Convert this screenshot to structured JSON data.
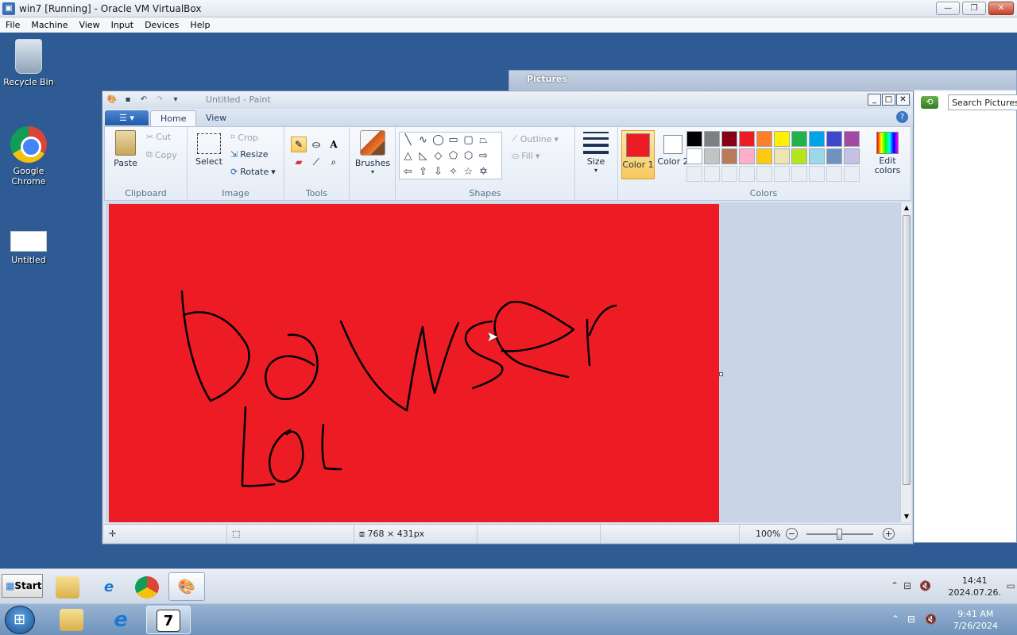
{
  "vbox": {
    "title": "win7 [Running] - Oracle VM VirtualBox",
    "menu": [
      "File",
      "Machine",
      "View",
      "Input",
      "Devices",
      "Help"
    ]
  },
  "desktop": {
    "icons": [
      {
        "label": "Recycle Bin",
        "icon": "recycle-bin-icon"
      },
      {
        "label": "Google Chrome",
        "icon": "chrome-icon"
      },
      {
        "label": "Untitled",
        "icon": "image-file-icon"
      }
    ]
  },
  "pictures": {
    "title": "Pictures",
    "search_placeholder": "Search Pictures"
  },
  "paint": {
    "title": "Untitled - Paint",
    "tabs": [
      "Home",
      "View"
    ],
    "clipboard": {
      "paste": "Paste",
      "cut": "Cut",
      "copy": "Copy",
      "label": "Clipboard"
    },
    "image": {
      "select": "Select",
      "crop": "Crop",
      "resize": "Resize",
      "rotate": "Rotate",
      "label": "Image"
    },
    "tools": {
      "label": "Tools"
    },
    "brushes": {
      "label": "Brushes"
    },
    "shapes": {
      "outline": "Outline",
      "fill": "Fill",
      "label": "Shapes"
    },
    "size": {
      "label": "Size"
    },
    "colors": {
      "color1_label": "Color 1",
      "color2_label": "Color 2",
      "color1": "#ed1c24",
      "color2": "#ffffff",
      "edit": "Edit colors",
      "label": "Colors",
      "palette_row1": [
        "#000000",
        "#7f7f7f",
        "#880015",
        "#ed1c24",
        "#ff7f27",
        "#fff200",
        "#22b14c",
        "#00a2e8",
        "#3f48cc",
        "#a349a4"
      ],
      "palette_row2": [
        "#ffffff",
        "#c3c3c3",
        "#b97a57",
        "#ffaec9",
        "#ffc90e",
        "#efe4b0",
        "#b5e61d",
        "#99d9ea",
        "#7092be",
        "#c8bfe7"
      ]
    },
    "canvas_text": "Dawser LoL",
    "status": {
      "dimensions": "768 × 431px",
      "zoom": "100%"
    }
  },
  "guest_taskbar": {
    "start": "Start",
    "time": "14:41",
    "date": "2024.07.26."
  },
  "host_taskbar": {
    "time": "9:41 AM",
    "date": "7/26/2024"
  }
}
